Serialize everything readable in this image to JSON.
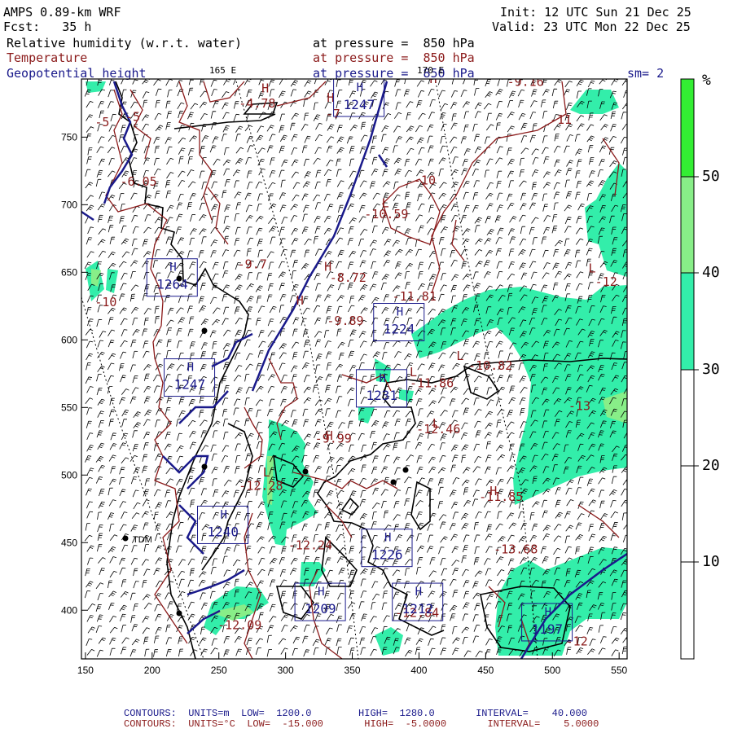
{
  "header": {
    "model": "AMPS 0.89-km WRF",
    "forecast": "Fcst:   35 h",
    "init": "Init: 12 UTC Sun 21 Dec 25",
    "valid": "Valid: 23 UTC Mon 22 Dec 25",
    "field1_label": "Relative humidity (w.r.t. water)",
    "field1_level": "at pressure =  850 hPa",
    "field2_label": "Temperature",
    "field2_level": "at pressure =  850 hPa",
    "field3_label": "Geopotential height",
    "field3_level": "at pressure =  850 hPa",
    "smoothing": "sm= 2",
    "lon1": "165 E",
    "lon2": "170 E"
  },
  "colorbar": {
    "unit": "%",
    "ticks": [
      "50",
      "40",
      "30",
      "20",
      "10"
    ],
    "colors": [
      "#33ee33",
      "#88ee88",
      "#33eeaa",
      "#ffffff",
      "#ffffff"
    ]
  },
  "axes": {
    "x_ticks": [
      "150",
      "200",
      "250",
      "300",
      "350",
      "400",
      "450",
      "500",
      "550"
    ],
    "y_ticks": [
      "750",
      "700",
      "650",
      "600",
      "550",
      "500",
      "450",
      "400"
    ],
    "xlim": [
      147,
      556
    ],
    "ylim": [
      364,
      793
    ]
  },
  "stations": {
    "tdm": "TDM"
  },
  "temperature_labels": [
    {
      "t": "-4.78",
      "x": 265,
      "y": 772
    },
    {
      "t": "-13",
      "x": 283,
      "y": 794
    },
    {
      "t": "-7",
      "x": 330,
      "y": 764
    },
    {
      "t": "-5",
      "x": 180,
      "y": 762
    },
    {
      "t": "-5",
      "x": 157,
      "y": 758
    },
    {
      "t": "-6.05",
      "x": 176,
      "y": 714
    },
    {
      "t": "-9.16",
      "x": 466,
      "y": 788
    },
    {
      "t": "-11",
      "x": 498,
      "y": 760
    },
    {
      "t": "-10",
      "x": 396,
      "y": 715
    },
    {
      "t": "-10.59",
      "x": 359,
      "y": 690
    },
    {
      "t": "-9.7",
      "x": 264,
      "y": 653
    },
    {
      "t": "-8.72",
      "x": 333,
      "y": 643
    },
    {
      "t": "-11.81",
      "x": 380,
      "y": 629
    },
    {
      "t": "-10",
      "x": 157,
      "y": 625
    },
    {
      "t": "-9.89",
      "x": 331,
      "y": 611
    },
    {
      "t": "-10.82",
      "x": 437,
      "y": 578
    },
    {
      "t": "-12",
      "x": 532,
      "y": 640
    },
    {
      "t": "-11.86",
      "x": 393,
      "y": 565
    },
    {
      "t": "-13",
      "x": 512,
      "y": 548
    },
    {
      "t": "-9.99",
      "x": 322,
      "y": 524
    },
    {
      "t": "-12.46",
      "x": 398,
      "y": 531
    },
    {
      "t": "-12.28",
      "x": 265,
      "y": 489
    },
    {
      "t": "-11.85",
      "x": 445,
      "y": 481
    },
    {
      "t": "-12.24",
      "x": 302,
      "y": 445
    },
    {
      "t": "-13.68",
      "x": 456,
      "y": 442
    },
    {
      "t": "-12.84",
      "x": 382,
      "y": 395
    },
    {
      "t": "-12.09",
      "x": 249,
      "y": 386
    },
    {
      "t": "-12",
      "x": 510,
      "y": 374
    }
  ],
  "extrema": [
    {
      "t": "H",
      "x": 331,
      "y": 776,
      "c": "#8b1a1a"
    },
    {
      "t": "H",
      "x": 408,
      "y": 790,
      "c": "#8b1a1a"
    },
    {
      "t": "L",
      "x": 372,
      "y": 698,
      "c": "#8b1a1a"
    },
    {
      "t": "H",
      "x": 329,
      "y": 651,
      "c": "#8b1a1a"
    },
    {
      "t": "L",
      "x": 393,
      "y": 573,
      "c": "#8b1a1a"
    },
    {
      "t": "L",
      "x": 428,
      "y": 585,
      "c": "#8b1a1a"
    },
    {
      "t": "H",
      "x": 330,
      "y": 526,
      "c": "#8b1a1a"
    },
    {
      "t": "L",
      "x": 410,
      "y": 535,
      "c": "#8b1a1a"
    },
    {
      "t": "H",
      "x": 453,
      "y": 485,
      "c": "#8b1a1a"
    },
    {
      "t": "L",
      "x": 283,
      "y": 499,
      "c": "#8b1a1a"
    },
    {
      "t": "H",
      "x": 308,
      "y": 626,
      "c": "#8b1a1a"
    },
    {
      "t": "L",
      "x": 527,
      "y": 650,
      "c": "#8b1a1a"
    },
    {
      "t": "H",
      "x": 282,
      "y": 783,
      "c": "#8b1a1a"
    }
  ],
  "height_boxes": [
    {
      "t": "1247",
      "x": 336,
      "y": 793
    },
    {
      "t": "1264",
      "x": 196,
      "y": 660
    },
    {
      "t": "1224",
      "x": 366,
      "y": 627
    },
    {
      "t": "1247",
      "x": 209,
      "y": 586
    },
    {
      "t": "1231",
      "x": 353,
      "y": 578
    },
    {
      "t": "1240",
      "x": 234,
      "y": 477
    },
    {
      "t": "1226",
      "x": 357,
      "y": 460
    },
    {
      "t": "1209",
      "x": 307,
      "y": 420
    },
    {
      "t": "1212",
      "x": 380,
      "y": 420
    },
    {
      "t": "1197",
      "x": 477,
      "y": 405
    }
  ],
  "footer": {
    "line1": "CONTOURS:  UNITS=m  LOW=  1200.0        HIGH=  1280.0       INTERVAL=    40.000",
    "line2": "CONTOURS:  UNITS=°C  LOW=  -15.000       HIGH=  -5.0000       INTERVAL=    5.0000"
  }
}
